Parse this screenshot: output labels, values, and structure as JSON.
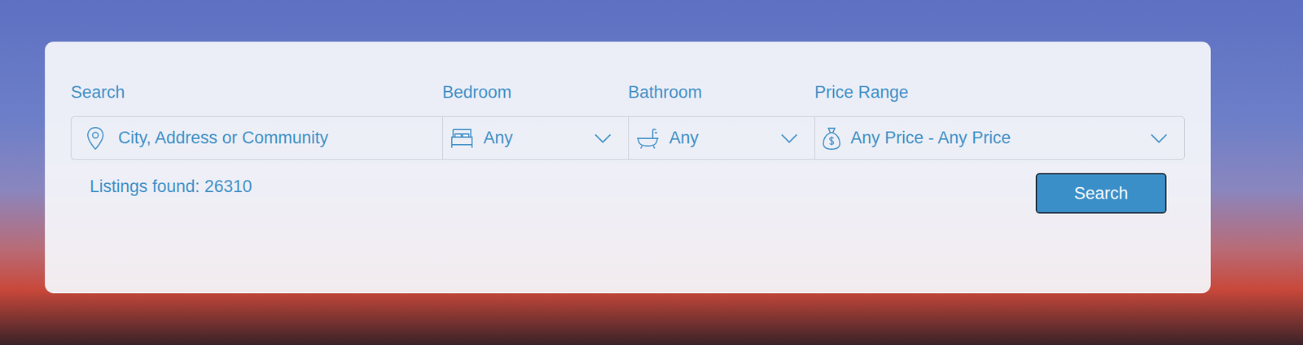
{
  "search": {
    "label": "Search",
    "placeholder": "City, Address or Community"
  },
  "filters": [
    {
      "kind": "bedroom",
      "label": "Bedroom",
      "value": "Any"
    },
    {
      "kind": "bathroom",
      "label": "Bathroom",
      "value": "Any"
    },
    {
      "kind": "price",
      "label": "Price Range",
      "value": "Any Price - Any Price"
    }
  ],
  "listings": "Listings found: 26310",
  "button": "Search"
}
